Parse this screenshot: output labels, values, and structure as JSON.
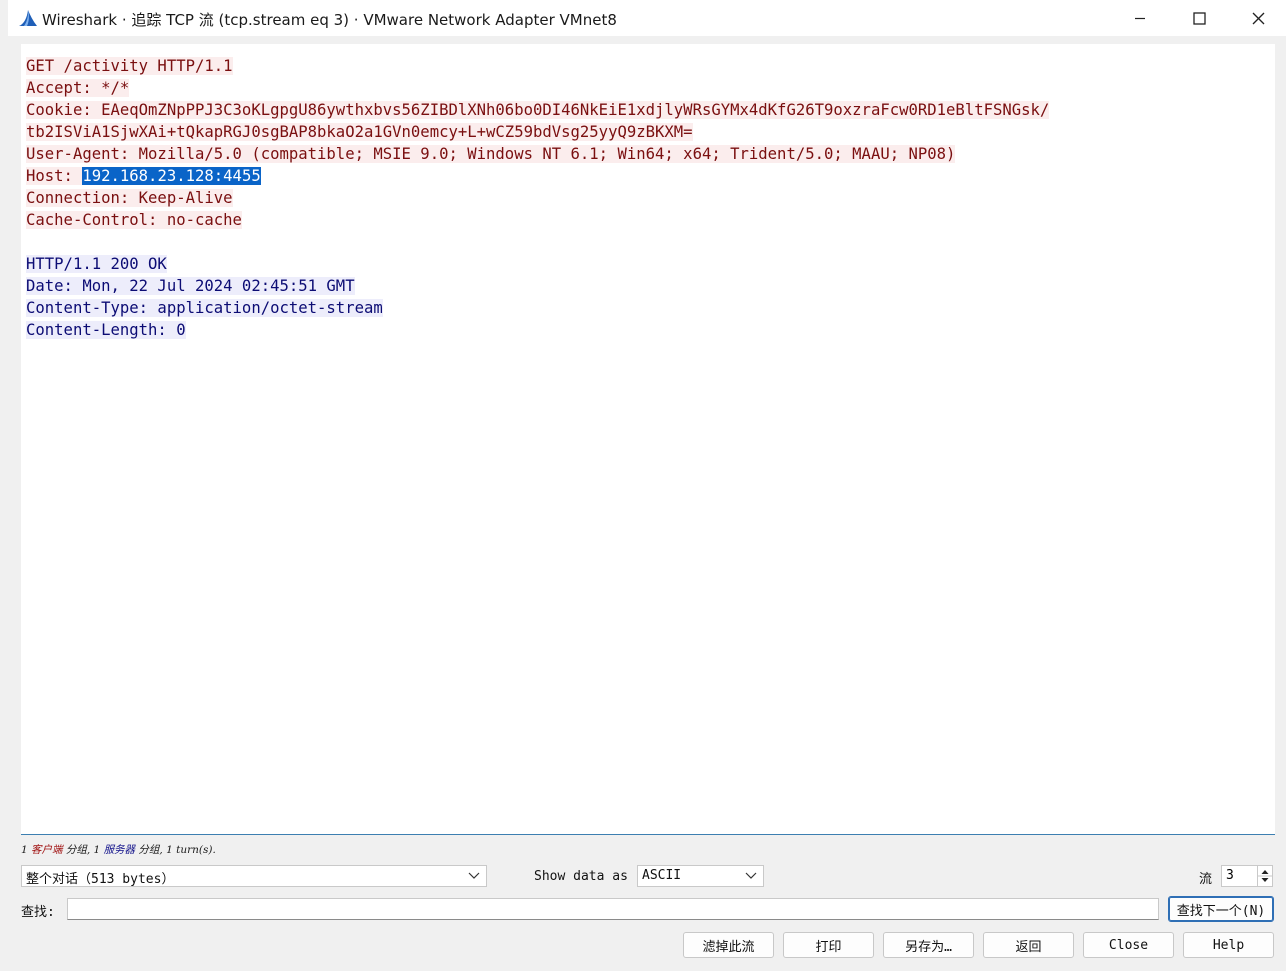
{
  "window": {
    "title": "Wireshark · 追踪 TCP 流 (tcp.stream eq 3) · VMware Network Adapter VMnet8"
  },
  "stream": {
    "client_lines": [
      "GET /activity HTTP/1.1",
      "Accept: */*",
      "Cookie: EAeqOmZNpPPJ3C3oKLgpgU86ywthxbvs56ZIBDlXNh06bo0DI46NkEiE1xdjlyWRsGYMx4dKfG26T9oxzraFcw0RD1eBltFSNGsk/",
      "tb2ISViA1SjwXAi+tQkapRGJ0sgBAP8bkaO2a1GVn0emcy+L+wCZ59bdVsg25yyQ9zBKXM=",
      "User-Agent: Mozilla/5.0 (compatible; MSIE 9.0; Windows NT 6.1; Win64; x64; Trident/5.0; MAAU; NP08)"
    ],
    "host_label": "Host: ",
    "host_value": "192.168.23.128:4455",
    "client_lines_after": [
      "Connection: Keep-Alive",
      "Cache-Control: no-cache"
    ],
    "server_lines": [
      "HTTP/1.1 200 OK",
      "Date: Mon, 22 Jul 2024 02:45:51 GMT",
      "Content-Type: application/octet-stream",
      "Content-Length: 0"
    ]
  },
  "summary": {
    "prefix": "1 ",
    "client": "客户端",
    "mid": " 分组, 1 ",
    "server": "服务器",
    "suffix": " 分组, 1 turn(s)."
  },
  "controls": {
    "conversation_value": "整个对话（513 bytes）",
    "show_data_label": "Show data as",
    "show_data_value": "ASCII",
    "stream_label": "流",
    "stream_value": "3",
    "find_label": "查找:",
    "find_value": "",
    "find_next_label": "查找下一个(N)"
  },
  "buttons": {
    "filter_out": "滤掉此流",
    "print": "打印",
    "save_as": "另存为…",
    "back": "返回",
    "close": "Close",
    "help": "Help"
  },
  "colors": {
    "client_text": "#7a0f10",
    "client_bg": "#fbeded",
    "server_text": "#0c0c74",
    "server_bg": "#ededfb",
    "selection": "#0a64c8"
  }
}
